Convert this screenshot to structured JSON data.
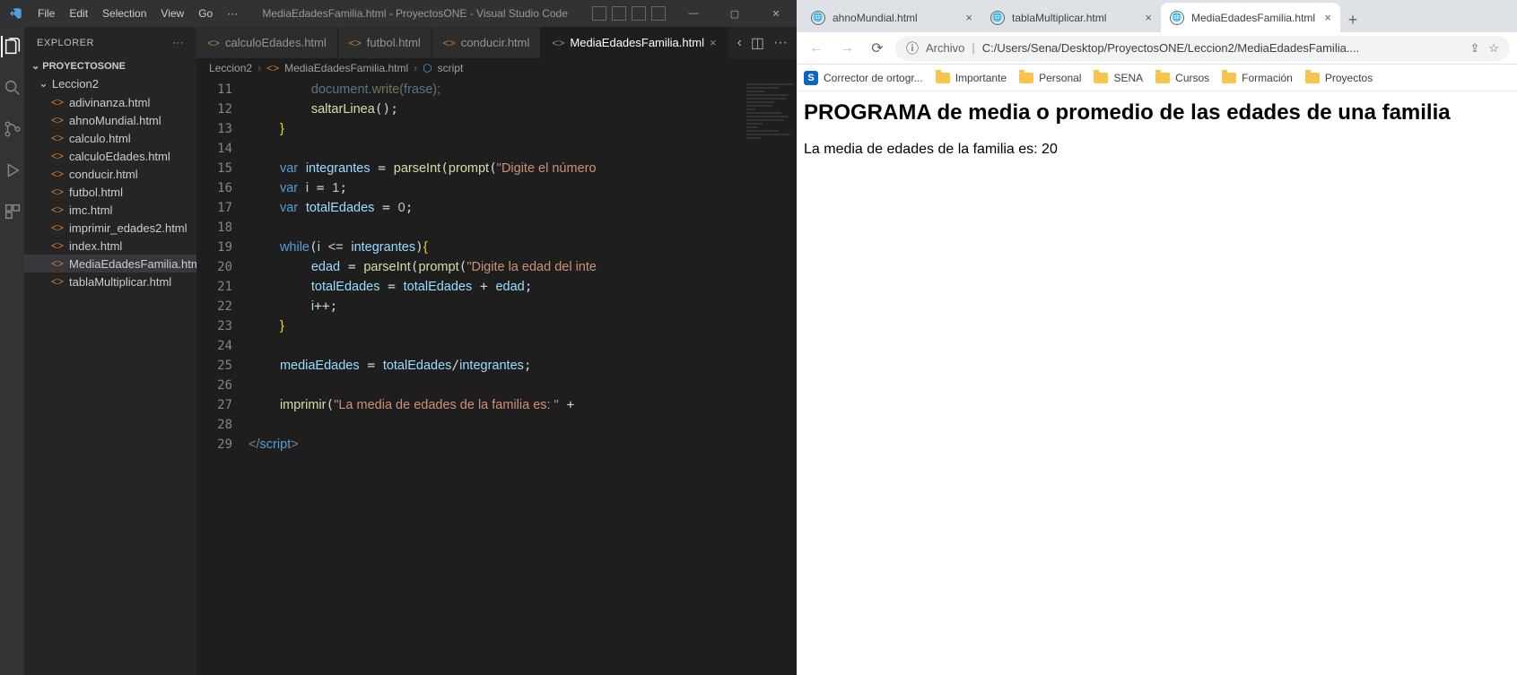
{
  "vscode": {
    "menu": [
      "File",
      "Edit",
      "Selection",
      "View",
      "Go",
      "···"
    ],
    "window_title": "MediaEdadesFamilia.html - ProyectosONE - Visual Studio Code",
    "explorer_label": "EXPLORER",
    "project_name": "PROYECTOSONE",
    "folder_name": "Leccion2",
    "files": [
      "adivinanza.html",
      "ahnoMundial.html",
      "calculo.html",
      "calculoEdades.html",
      "conducir.html",
      "futbol.html",
      "imc.html",
      "imprimir_edades2.html",
      "index.html",
      "MediaEdadesFamilia.html",
      "tablaMultiplicar.html"
    ],
    "active_file_index": 9,
    "open_tabs": [
      {
        "label": "calculoEdades.html",
        "active": false
      },
      {
        "label": "futbol.html",
        "active": false
      },
      {
        "label": "conducir.html",
        "active": false
      },
      {
        "label": "MediaEdadesFamilia.html",
        "active": true
      }
    ],
    "breadcrumb": [
      "Leccion2",
      "MediaEdadesFamilia.html",
      "script"
    ],
    "line_numbers": [
      11,
      12,
      13,
      14,
      15,
      16,
      17,
      18,
      19,
      20,
      21,
      22,
      23,
      24,
      25,
      26,
      27,
      28,
      29
    ],
    "code": {
      "l11_obj": "document",
      "l11_m": "write",
      "l11_arg": "frase",
      "l12_fn": "saltarLinea",
      "l15_kw": "var",
      "l15_name": "integrantes",
      "l15_fn": "parseInt",
      "l15_fn2": "prompt",
      "l15_str": "\"Digite el número",
      "l16_kw": "var",
      "l16_name": "i",
      "l16_val": "1",
      "l17_kw": "var",
      "l17_name": "totalEdades",
      "l17_val": "0",
      "l19_kw": "while",
      "l19_i": "i",
      "l19_op": "<=",
      "l19_r": "integrantes",
      "l20_name": "edad",
      "l20_fn": "parseInt",
      "l20_fn2": "prompt",
      "l20_str": "\"Digite la edad del inte",
      "l21_l": "totalEdades",
      "l21_r1": "totalEdades",
      "l21_r2": "edad",
      "l22_name": "i",
      "l25_l": "mediaEdades",
      "l25_r1": "totalEdades",
      "l25_r2": "integrantes",
      "l27_fn": "imprimir",
      "l27_str": "\"La media de edades de la familia es: \"",
      "l29_tag": "script"
    }
  },
  "browser": {
    "tabs": [
      {
        "label": "ahnoMundial.html",
        "active": false
      },
      {
        "label": "tablaMultiplicar.html",
        "active": false
      },
      {
        "label": "MediaEdadesFamilia.html",
        "active": true
      }
    ],
    "address_label": "Archivo",
    "url": "C:/Users/Sena/Desktop/ProyectosONE/Leccion2/MediaEdadesFamilia....",
    "bookmarks": [
      {
        "label": "Corrector de ortogr...",
        "type": "s"
      },
      {
        "label": "Importante",
        "type": "folder"
      },
      {
        "label": "Personal",
        "type": "folder"
      },
      {
        "label": "SENA",
        "type": "folder"
      },
      {
        "label": "Cursos",
        "type": "folder"
      },
      {
        "label": "Formación",
        "type": "folder"
      },
      {
        "label": "Proyectos",
        "type": "folder"
      }
    ],
    "page_heading": "PROGRAMA de media o promedio de las edades de una familia",
    "page_text": "La media de edades de la familia es: 20"
  }
}
